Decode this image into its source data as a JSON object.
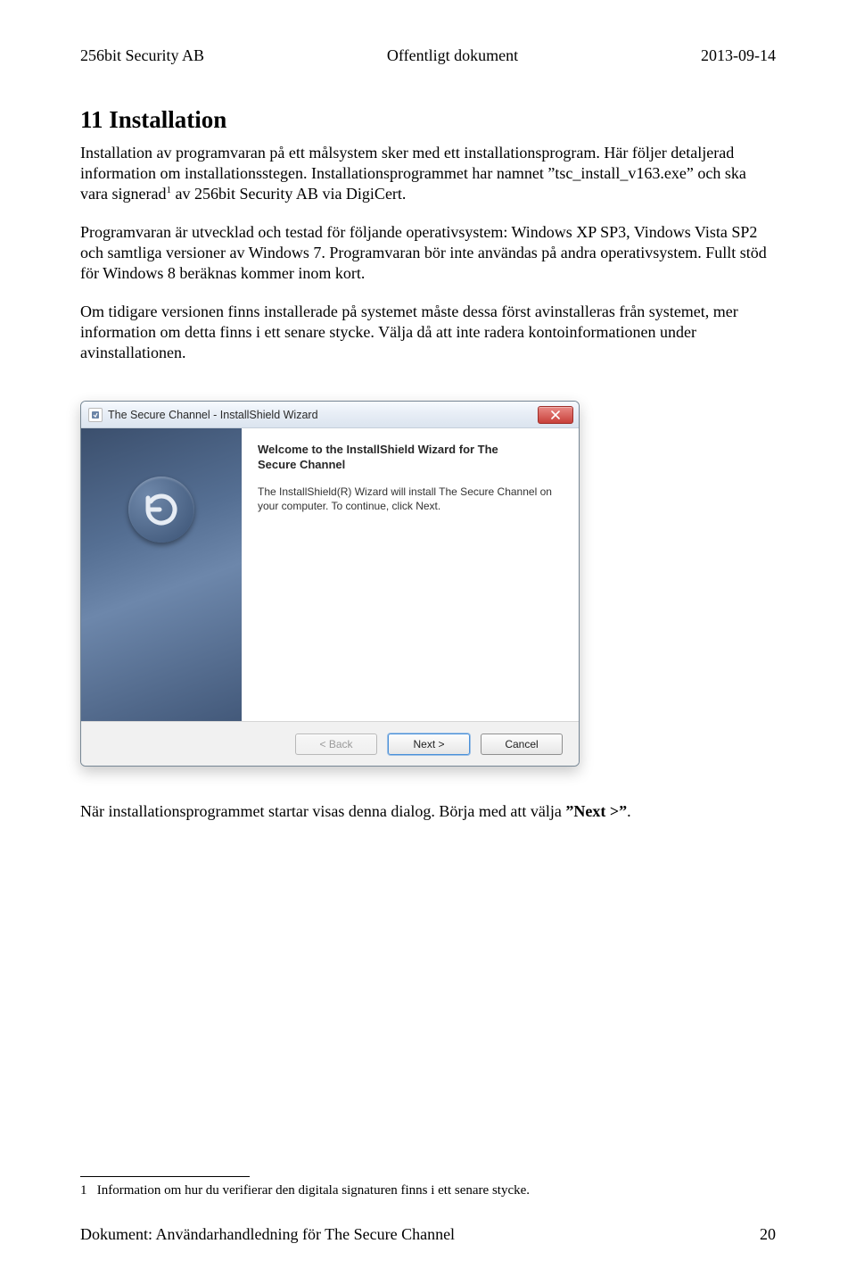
{
  "header": {
    "left": "256bit Security AB",
    "center": "Offentligt dokument",
    "right": "2013-09-14"
  },
  "section": {
    "title": "11 Installation",
    "p1": "Installation av programvaran på ett målsystem sker med ett installationsprogram. Här följer detaljerad information om installationsstegen. Installationsprogrammet har namnet ”tsc_install_v163.exe” och ska vara signerad",
    "p1_after": " av 256bit Security AB via DigiCert.",
    "p2": "Programvaran är utvecklad och testad för följande operativsystem: Windows XP SP3, Vindows Vista SP2 och samtliga versioner av Windows 7. Programvaran bör inte användas på andra operativsystem. Fullt stöd för Windows 8 beräknas kommer inom kort.",
    "p3": "Om tidigare versionen finns installerade på systemet måste dessa först avinstalleras från systemet, mer information om detta finns i ett senare stycke. Välja då att inte radera kontoinformationen under avinstallationen."
  },
  "dialog": {
    "title": "The Secure Channel - InstallShield Wizard",
    "welcome_l1": "Welcome to the InstallShield Wizard for The",
    "welcome_l2": "Secure Channel",
    "info": "The InstallShield(R) Wizard will install The Secure Channel on your computer. To continue, click Next.",
    "back": "< Back",
    "next": "Next >",
    "cancel": "Cancel"
  },
  "caption": {
    "pre": "När installationsprogrammet startar visas denna dialog. Börja med att välja ",
    "bold": "”Next >”",
    "post": "."
  },
  "footnote": {
    "num": "1",
    "text": "Information om hur du verifierar den digitala signaturen finns i ett senare stycke."
  },
  "footer": {
    "left": "Dokument: Användarhandledning för The Secure Channel",
    "right": "20"
  }
}
